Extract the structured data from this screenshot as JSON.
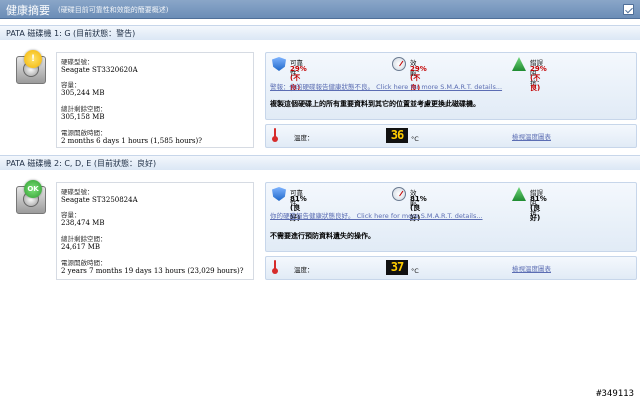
{
  "header": {
    "title": "健康摘要",
    "subtitle": "(硬碟目前可靠性和效能的簡要概述)"
  },
  "drives": [
    {
      "section_label": "PATA 磁碟機 1: G (目前狀態：警告)",
      "status": "warning",
      "badge": "!",
      "model_label": "硬碟型號：",
      "model": "Seagate ST3320620A",
      "capacity_label": "容量：",
      "capacity": "305,244 MB",
      "free_label": "總計剩餘空間：",
      "free": "305,158 MB",
      "power_label": "電源開啟時間：",
      "power": "2 months 6 days 1 hours (1,585 hours)?",
      "reliability_label": "可靠性：",
      "reliability": "29% (不良)",
      "performance_label": "效能：",
      "performance": "29% (不良)",
      "error_label": "錯誤阻抗：",
      "error": "29% (不良)",
      "value_color": "#c30000",
      "smart_link": "警報：你的硬碟報告健康狀態不良。 Click here for more S.M.A.R.T. details...",
      "advice": "複製這個硬碟上的所有重要資料到其它的位置並考慮更換此磁碟機。",
      "temp_label": "溫度：",
      "temp": "36",
      "temp_unit": "°C",
      "temp_link": "檢視溫度圖表"
    },
    {
      "section_label": "PATA 磁碟機 2: C, D, E (目前狀態：良好)",
      "status": "ok",
      "badge": "OK",
      "model_label": "硬碟型號：",
      "model": "Seagate ST3250824A",
      "capacity_label": "容量：",
      "capacity": "238,474 MB",
      "free_label": "總計剩餘空間：",
      "free": "24,617 MB",
      "power_label": "電源開啟時間：",
      "power": "2 years 7 months 19 days 13 hours (23,029 hours)?",
      "reliability_label": "可靠性：",
      "reliability": "81% (良好)",
      "performance_label": "效能：",
      "performance": "81% (良好)",
      "error_label": "錯誤阻抗：",
      "error": "81% (良好)",
      "value_color": "#000000",
      "smart_link": "你的硬碟報告健康狀態良好。 Click here for more S.M.A.R.T. details...",
      "advice": "不需要進行預防資料遺失的操作。",
      "temp_label": "溫度：",
      "temp": "37",
      "temp_unit": "°C",
      "temp_link": "檢視溫度圖表"
    }
  ],
  "watermark": "#349113"
}
